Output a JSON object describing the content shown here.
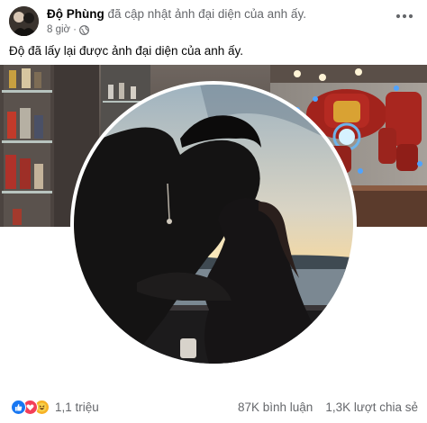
{
  "post": {
    "author": "Độ Phùng",
    "action": "đã cập nhật ảnh đại diện của anh ấy.",
    "time": "8 giờ",
    "separator": "·",
    "privacy_icon": "globe-icon",
    "more_icon": "more-options-icon",
    "caption": "Độ đã lấy lại được ảnh đại diện của anh ấy."
  },
  "footer": {
    "reaction_icons": [
      "like-icon",
      "love-icon",
      "haha-icon"
    ],
    "reaction_count": "1,1 triệu",
    "comments": "87K bình luận",
    "shares": "1,3K lượt chia sẻ"
  },
  "colors": {
    "like": "#1877f2",
    "love": "#f33e58",
    "haha": "#f7b125",
    "secondary_text": "#65676b"
  }
}
